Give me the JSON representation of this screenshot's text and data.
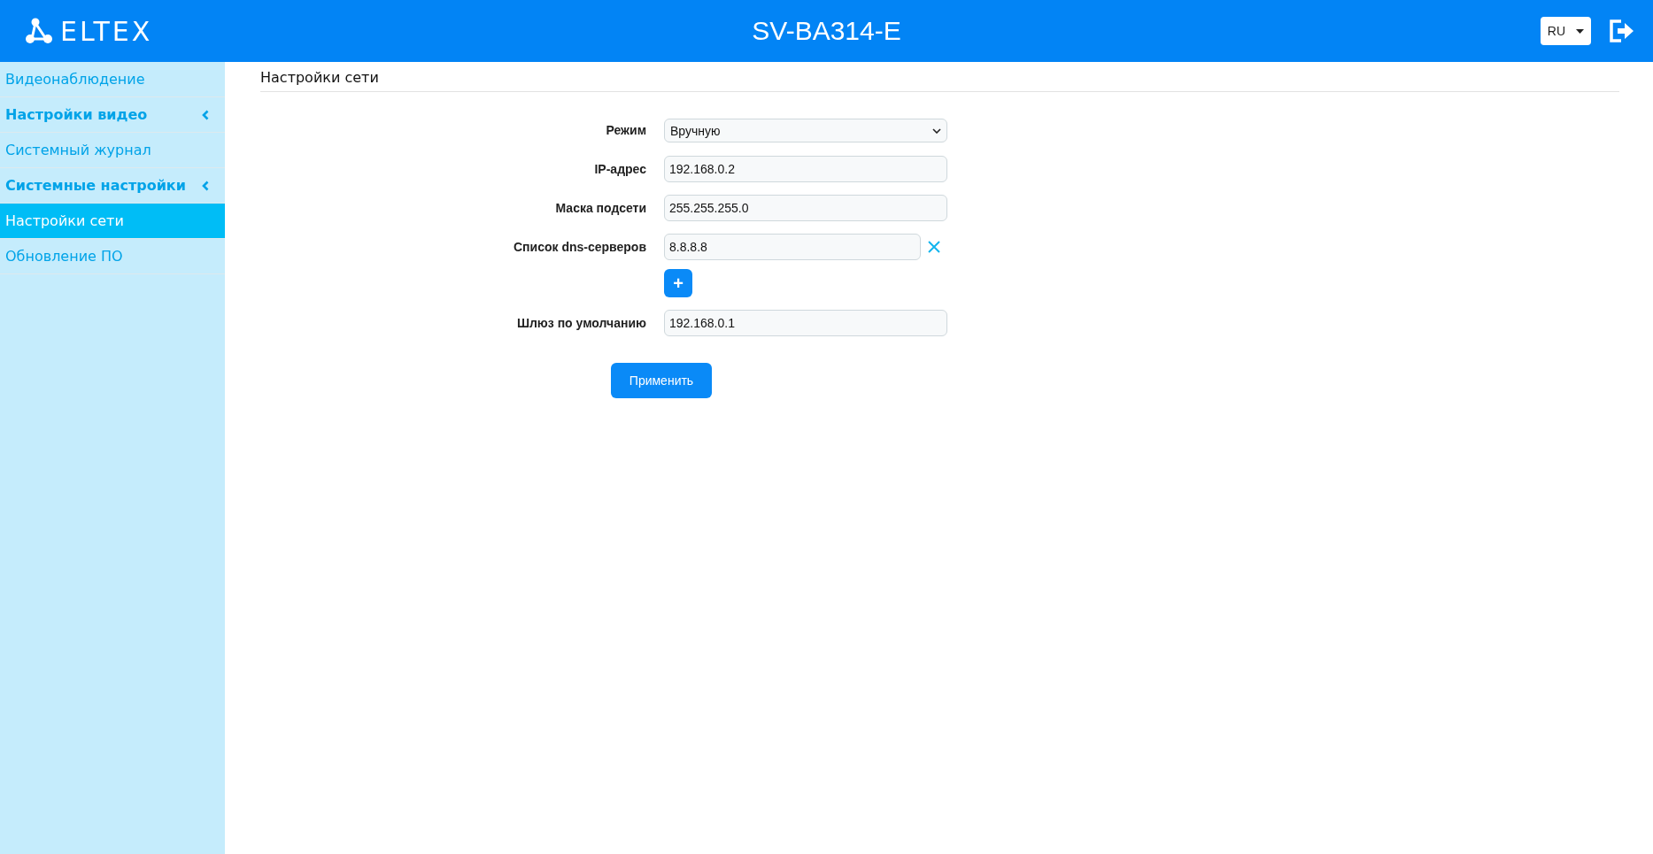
{
  "header": {
    "logo": "ELTEX",
    "title": "SV-BA314-E",
    "language": "RU"
  },
  "sidebar": {
    "items": [
      {
        "label": "Видеонаблюдение",
        "kind": "link",
        "selected": false
      },
      {
        "label": "Настройки видео",
        "kind": "group",
        "selected": false
      },
      {
        "label": "Системный журнал",
        "kind": "link",
        "selected": false
      },
      {
        "label": "Системные настройки",
        "kind": "group",
        "selected": false
      },
      {
        "label": "Настройки сети",
        "kind": "link",
        "selected": true
      },
      {
        "label": "Обновление ПО",
        "kind": "link",
        "selected": false
      }
    ]
  },
  "page": {
    "title": "Настройки сети",
    "fields": [
      {
        "label": "Режим",
        "kind": "select",
        "value": "Вручную"
      },
      {
        "label": "IP-адрес",
        "kind": "input",
        "value": "192.168.0.2"
      },
      {
        "label": "Маска подсети",
        "kind": "input",
        "value": "255.255.255.0"
      },
      {
        "label": "Список dns-серверов",
        "kind": "list",
        "values": [
          "8.8.8.8"
        ],
        "add_button": "+"
      },
      {
        "label": "Шлюз по умолчанию",
        "kind": "input",
        "value": "192.168.0.1"
      }
    ],
    "apply_button": "Применить"
  }
}
